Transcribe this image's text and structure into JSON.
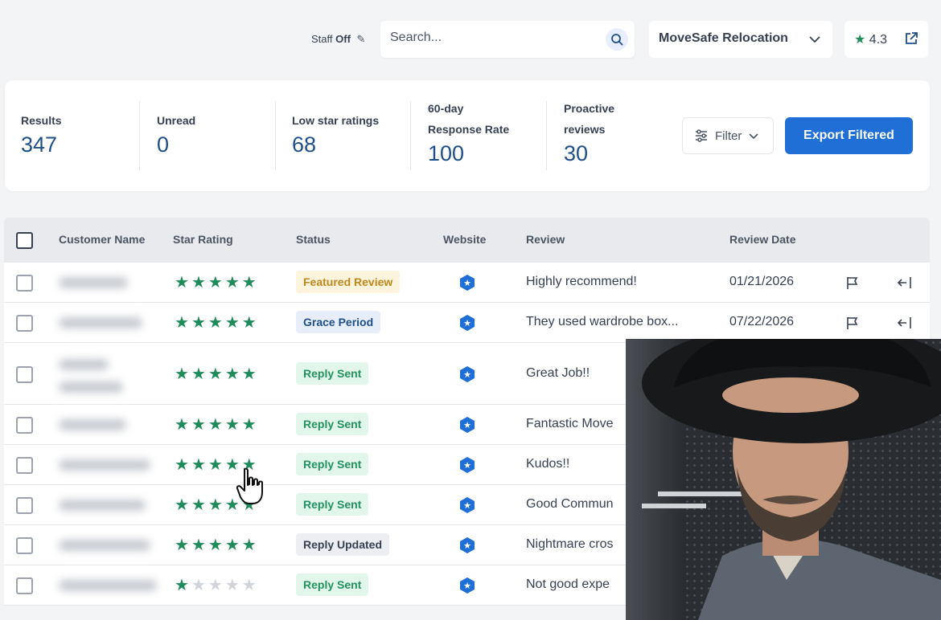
{
  "topbar": {
    "staff_label": "Staff",
    "staff_state": "Off",
    "search_placeholder": "Search...",
    "company_name": "MoveSafe Relocation",
    "rating": "4.3"
  },
  "stats": [
    {
      "label_lines": [
        "Results"
      ],
      "value": "347"
    },
    {
      "label_lines": [
        "Unread"
      ],
      "value": "0"
    },
    {
      "label_lines": [
        "Low star ratings"
      ],
      "value": "68"
    },
    {
      "label_lines": [
        "60-day",
        "Response Rate"
      ],
      "value": "100"
    },
    {
      "label_lines": [
        "Proactive",
        "reviews"
      ],
      "value": "30"
    }
  ],
  "actions": {
    "filter_label": "Filter",
    "export_label": "Export Filtered"
  },
  "table": {
    "headers": [
      "Customer Name",
      "Star Rating",
      "Status",
      "Website",
      "Review",
      "Review Date"
    ],
    "rows": [
      {
        "stars": 5,
        "status": "Featured Review",
        "status_type": "featured",
        "review": "Highly recommend!",
        "date": "01/21/2026"
      },
      {
        "stars": 5,
        "status": "Grace Period",
        "status_type": "grace",
        "review": "They used wardrobe box...",
        "date": "07/22/2026"
      },
      {
        "stars": 5,
        "status": "Reply Sent",
        "status_type": "sent",
        "review": "Great Job!!",
        "date": ""
      },
      {
        "stars": 5,
        "status": "Reply Sent",
        "status_type": "sent",
        "review": "Fantastic Move",
        "date": ""
      },
      {
        "stars": 5,
        "status": "Reply Sent",
        "status_type": "sent",
        "review": "Kudos!!",
        "date": ""
      },
      {
        "stars": 5,
        "status": "Reply Sent",
        "status_type": "sent",
        "review": "Good Commun",
        "date": ""
      },
      {
        "stars": 5,
        "status": "Reply Updated",
        "status_type": "updated",
        "review": "Nightmare cros",
        "date": ""
      },
      {
        "stars": 1,
        "status": "Reply Sent",
        "status_type": "sent",
        "review": "Not good expe",
        "date": ""
      }
    ]
  },
  "colors": {
    "accent": "#1f6fd6",
    "stat_value": "#1e4f8a",
    "star_green": "#1f8a5a"
  }
}
